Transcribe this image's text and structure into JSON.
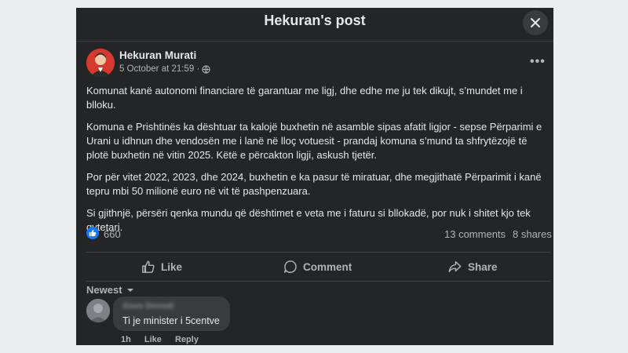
{
  "dialog": {
    "title": "Hekuran's post",
    "close_icon": "close-icon"
  },
  "post": {
    "author": "Hekuran Murati",
    "timestamp": "5 October at 21:59 ·",
    "privacy_icon": "globe-icon",
    "more_icon": "more-options-icon",
    "more_label": "•••",
    "paragraphs": [
      "Komunat kanë autonomi financiare të garantuar me ligj, dhe edhe me ju tek dikujt, s’mundet me i blloku.",
      "Komuna e Prishtinës ka dështuar ta kalojë buxhetin në asamble sipas afatit ligjor - sepse Përparimi e Urani u idhnun dhe vendosën me i lanë në lloç votuesit - prandaj komuna s’mund ta shfrytëzojë të plotë buxhetin në vitin 2025. Këtë e përcakton ligji, askush tjetër.",
      "Por për vitet 2022, 2023, dhe 2024, buxhetin e ka pasur të miratuar, dhe megjithatë Përparimit i kanë tepru mbi 50 milionë euro në vit të pashpenzuara.",
      "Si gjithnjë, përsëri qenka mundu që dështimet e veta me i faturu si bllokadë, por nuk i shitet kjo tek qytetari."
    ],
    "stats": {
      "likes": "660",
      "comments": "13 comments",
      "shares": "8 shares"
    }
  },
  "actions": {
    "like": "Like",
    "comment": "Comment",
    "share": "Share"
  },
  "comments_section": {
    "sort_label": "Newest",
    "comments": [
      {
        "author": "Sisos Doosali",
        "text": "Ti je minister i 5centve",
        "time": "1h",
        "like": "Like",
        "reply": "Reply"
      }
    ]
  },
  "colors": {
    "background": "#242526",
    "text": "#e4e6eb",
    "secondary": "#b0b3b8",
    "accent": "#1877f2"
  }
}
